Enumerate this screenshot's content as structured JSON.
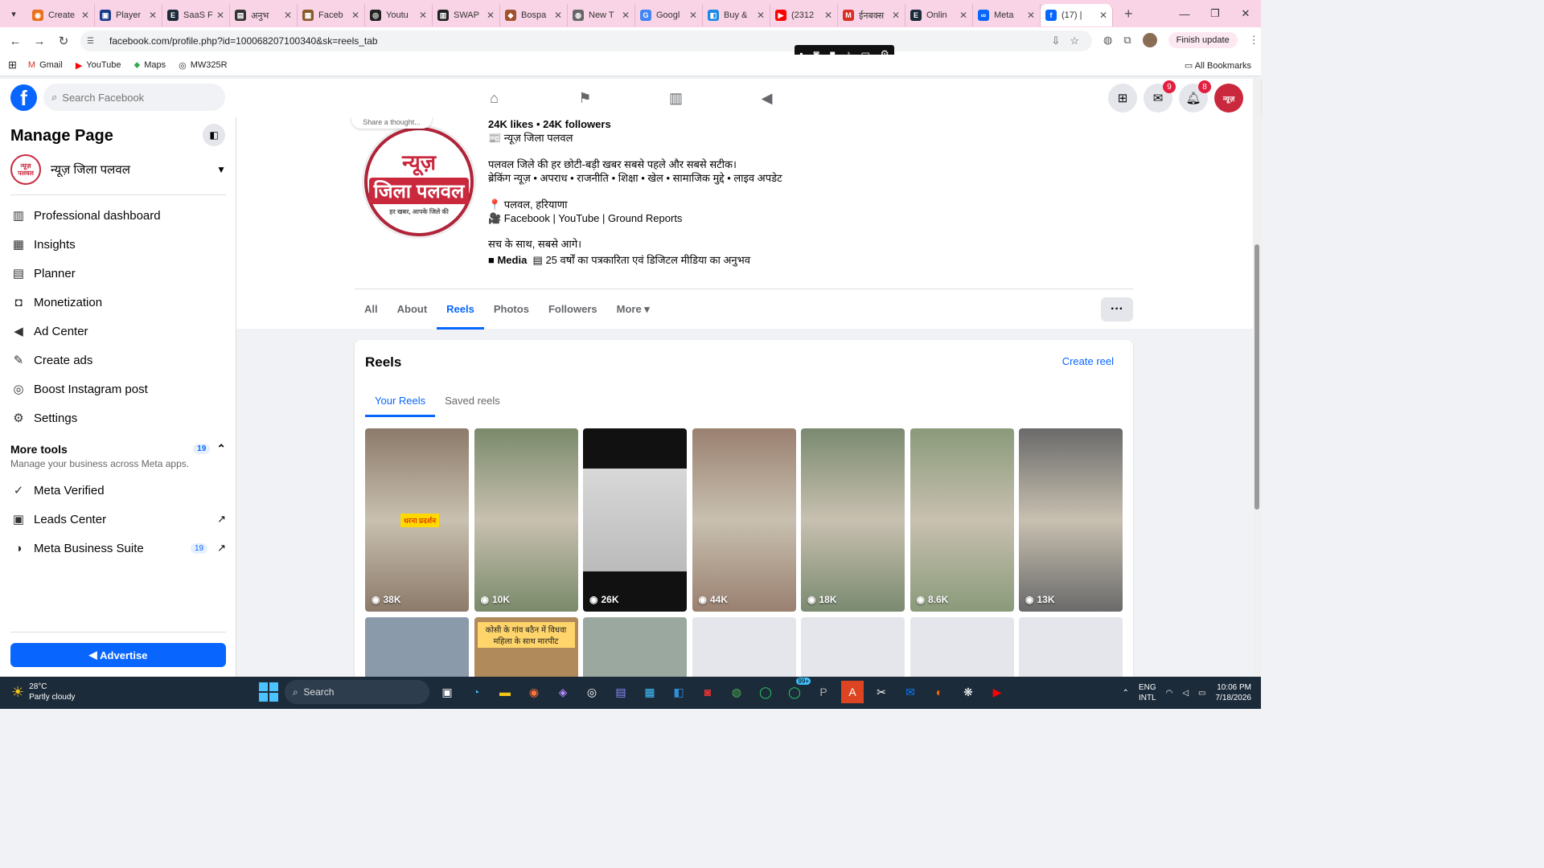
{
  "browser": {
    "tabs": [
      {
        "title": "Create",
        "color": "#e8711a",
        "glyph": "◉"
      },
      {
        "title": "Player",
        "color": "#1a3a8a",
        "glyph": "▣"
      },
      {
        "title": "SaaS F",
        "color": "#1c2b3a",
        "glyph": "E"
      },
      {
        "title": "अनुभ",
        "color": "#333333",
        "glyph": "▤"
      },
      {
        "title": "Faceb",
        "color": "#8a5a2a",
        "glyph": "▦"
      },
      {
        "title": "Youtu",
        "color": "#222222",
        "glyph": "◎"
      },
      {
        "title": "SWAP",
        "color": "#222222",
        "glyph": "▥"
      },
      {
        "title": "Bospa",
        "color": "#a0522d",
        "glyph": "◆"
      },
      {
        "title": "New T",
        "color": "#666666",
        "glyph": "◍"
      },
      {
        "title": "Googl",
        "color": "#4285f4",
        "glyph": "G"
      },
      {
        "title": "Buy &",
        "color": "#1e88e5",
        "glyph": "◧"
      },
      {
        "title": "(2312",
        "color": "#ff0000",
        "glyph": "▶"
      },
      {
        "title": "ईनबक्स",
        "color": "#d93025",
        "glyph": "M"
      },
      {
        "title": "Onlin",
        "color": "#1c2b3a",
        "glyph": "E"
      },
      {
        "title": "Meta",
        "color": "#0866ff",
        "glyph": "∞"
      },
      {
        "title": "(17) |",
        "color": "#0866ff",
        "glyph": "f",
        "active": true
      }
    ],
    "url": "facebook.com/profile.php?id=100068207100340&sk=reels_tab",
    "finish_update": "Finish update",
    "bookmarks": [
      {
        "label": "Gmail",
        "icon": "gmail-icon",
        "glyph": "M",
        "color": "#d93025"
      },
      {
        "label": "YouTube",
        "icon": "youtube-icon",
        "glyph": "▶",
        "color": "#ff0000"
      },
      {
        "label": "Maps",
        "icon": "maps-icon",
        "glyph": "⬥",
        "color": "#34a853"
      },
      {
        "label": "MW325R",
        "icon": "globe-icon",
        "glyph": "◎",
        "color": "#333333"
      }
    ],
    "all_bookmarks": "All Bookmarks"
  },
  "fb": {
    "search_placeholder": "Search Facebook",
    "messenger_badge": "9",
    "notif_badge": "8"
  },
  "sidebar": {
    "title": "Manage Page",
    "page_name": "न्यूज़ जिला पलवल",
    "items": [
      {
        "label": "Professional dashboard",
        "icon": "dashboard-icon",
        "glyph": "▥"
      },
      {
        "label": "Insights",
        "icon": "insights-icon",
        "glyph": "▦"
      },
      {
        "label": "Planner",
        "icon": "planner-icon",
        "glyph": "▤"
      },
      {
        "label": "Monetization",
        "icon": "monetization-icon",
        "glyph": "◘"
      },
      {
        "label": "Ad Center",
        "icon": "megaphone-icon",
        "glyph": "◀"
      },
      {
        "label": "Create ads",
        "icon": "pencil-icon",
        "glyph": "✎"
      },
      {
        "label": "Boost Instagram post",
        "icon": "instagram-icon",
        "glyph": "◎"
      },
      {
        "label": "Settings",
        "icon": "gear-icon",
        "glyph": "⚙"
      }
    ],
    "more_tools": {
      "title": "More tools",
      "count": "19",
      "subtitle": "Manage your business across Meta apps."
    },
    "tools": [
      {
        "label": "Meta Verified",
        "icon": "verified-icon",
        "glyph": "✓",
        "trail": ""
      },
      {
        "label": "Leads Center",
        "icon": "leads-icon",
        "glyph": "▣",
        "trail": "↗"
      },
      {
        "label": "Meta Business Suite",
        "icon": "business-suite-icon",
        "glyph": "◑",
        "trail": "↗",
        "count": "19"
      }
    ],
    "advertise": "Advertise"
  },
  "profile": {
    "avatar_line1": "न्यूज़",
    "avatar_line2": "जिला पलवल",
    "avatar_line3": "हर खबर, आपके जिले की",
    "thought": "Share a thought...",
    "stats": "24K likes • 24K followers",
    "category": "📰 न्यूज़ जिला पलवल",
    "bio1": "पलवल जिले की हर छोटी-बड़ी खबर सबसे पहले और सबसे सटीक।",
    "bio2": "ब्रेकिंग न्यूज़ • अपराध • राजनीति • शिक्षा • खेल • सामाजिक मुद्दे • लाइव अपडेट",
    "location": "📍 पलवल, हरियाणा",
    "platforms": "🎥 Facebook | YouTube | Ground Reports",
    "motto": "सच के साथ, सबसे आगे।",
    "media": "■ Media",
    "experience": "▤ 25 वर्षों का पत्रकारिता एवं डिजिटल मीडिया का अनुभव"
  },
  "profile_tabs": [
    "All",
    "About",
    "Reels",
    "Photos",
    "Followers",
    "More ▾"
  ],
  "reels": {
    "title": "Reels",
    "create": "Create reel",
    "subtabs": [
      "Your Reels",
      "Saved reels"
    ],
    "items": [
      {
        "views": "38K",
        "bg": "#8c7a6a",
        "caption": "धरना प्रदर्शन"
      },
      {
        "views": "10K",
        "bg": "#7a8a6a",
        "caption": ""
      },
      {
        "views": "26K",
        "bg": "#1a1a1a",
        "caption": ""
      },
      {
        "views": "44K",
        "bg": "#9a8070",
        "caption": ""
      },
      {
        "views": "18K",
        "bg": "#7a8a70",
        "caption": ""
      },
      {
        "views": "8.6K",
        "bg": "#8a9a7a",
        "caption": ""
      },
      {
        "views": "13K",
        "bg": "#6a6a6a",
        "caption": ""
      }
    ],
    "row2": [
      {
        "bg": "#8a9aaa",
        "caption": ""
      },
      {
        "bg": "#b08a5a",
        "caption": "कोसी के गांव बठैन में विधवा महिला के साथ मारपीट"
      },
      {
        "bg": "#9aa8a0",
        "caption": ""
      },
      {
        "bg": "#e4e6eb",
        "caption": ""
      },
      {
        "bg": "#e4e6eb",
        "caption": ""
      },
      {
        "bg": "#e4e6eb",
        "caption": ""
      },
      {
        "bg": "#e4e6eb",
        "caption": ""
      }
    ]
  },
  "taskbar": {
    "temp": "28°C",
    "weather": "Partly cloudy",
    "search": "Search",
    "badge": "99+",
    "lang1": "ENG",
    "lang2": "INTL",
    "time": "10:06 PM",
    "date": "7/18/2026"
  }
}
